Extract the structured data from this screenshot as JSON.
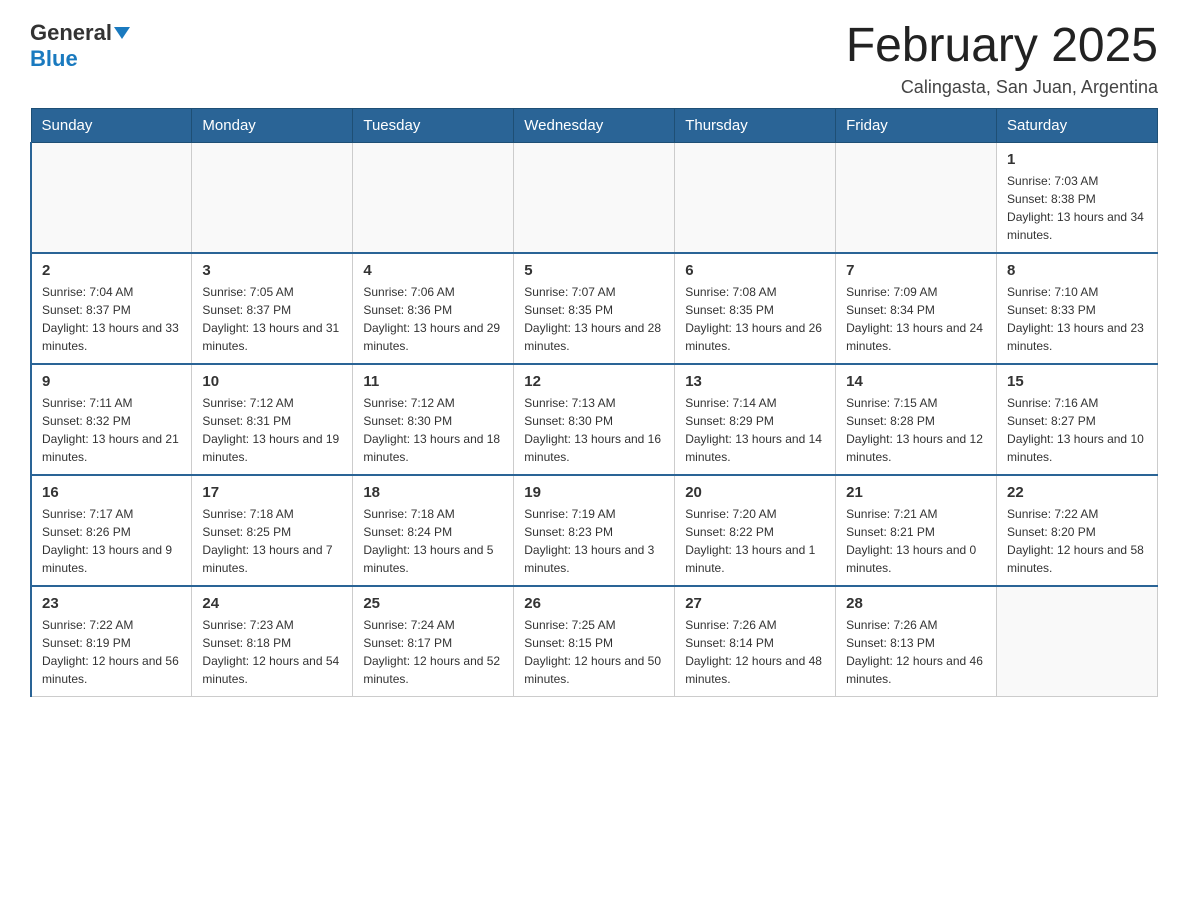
{
  "header": {
    "logo_general": "General",
    "logo_blue": "Blue",
    "title": "February 2025",
    "subtitle": "Calingasta, San Juan, Argentina"
  },
  "days_of_week": [
    "Sunday",
    "Monday",
    "Tuesday",
    "Wednesday",
    "Thursday",
    "Friday",
    "Saturday"
  ],
  "weeks": [
    {
      "days": [
        {
          "date": "",
          "info": ""
        },
        {
          "date": "",
          "info": ""
        },
        {
          "date": "",
          "info": ""
        },
        {
          "date": "",
          "info": ""
        },
        {
          "date": "",
          "info": ""
        },
        {
          "date": "",
          "info": ""
        },
        {
          "date": "1",
          "info": "Sunrise: 7:03 AM\nSunset: 8:38 PM\nDaylight: 13 hours and 34 minutes."
        }
      ]
    },
    {
      "days": [
        {
          "date": "2",
          "info": "Sunrise: 7:04 AM\nSunset: 8:37 PM\nDaylight: 13 hours and 33 minutes."
        },
        {
          "date": "3",
          "info": "Sunrise: 7:05 AM\nSunset: 8:37 PM\nDaylight: 13 hours and 31 minutes."
        },
        {
          "date": "4",
          "info": "Sunrise: 7:06 AM\nSunset: 8:36 PM\nDaylight: 13 hours and 29 minutes."
        },
        {
          "date": "5",
          "info": "Sunrise: 7:07 AM\nSunset: 8:35 PM\nDaylight: 13 hours and 28 minutes."
        },
        {
          "date": "6",
          "info": "Sunrise: 7:08 AM\nSunset: 8:35 PM\nDaylight: 13 hours and 26 minutes."
        },
        {
          "date": "7",
          "info": "Sunrise: 7:09 AM\nSunset: 8:34 PM\nDaylight: 13 hours and 24 minutes."
        },
        {
          "date": "8",
          "info": "Sunrise: 7:10 AM\nSunset: 8:33 PM\nDaylight: 13 hours and 23 minutes."
        }
      ]
    },
    {
      "days": [
        {
          "date": "9",
          "info": "Sunrise: 7:11 AM\nSunset: 8:32 PM\nDaylight: 13 hours and 21 minutes."
        },
        {
          "date": "10",
          "info": "Sunrise: 7:12 AM\nSunset: 8:31 PM\nDaylight: 13 hours and 19 minutes."
        },
        {
          "date": "11",
          "info": "Sunrise: 7:12 AM\nSunset: 8:30 PM\nDaylight: 13 hours and 18 minutes."
        },
        {
          "date": "12",
          "info": "Sunrise: 7:13 AM\nSunset: 8:30 PM\nDaylight: 13 hours and 16 minutes."
        },
        {
          "date": "13",
          "info": "Sunrise: 7:14 AM\nSunset: 8:29 PM\nDaylight: 13 hours and 14 minutes."
        },
        {
          "date": "14",
          "info": "Sunrise: 7:15 AM\nSunset: 8:28 PM\nDaylight: 13 hours and 12 minutes."
        },
        {
          "date": "15",
          "info": "Sunrise: 7:16 AM\nSunset: 8:27 PM\nDaylight: 13 hours and 10 minutes."
        }
      ]
    },
    {
      "days": [
        {
          "date": "16",
          "info": "Sunrise: 7:17 AM\nSunset: 8:26 PM\nDaylight: 13 hours and 9 minutes."
        },
        {
          "date": "17",
          "info": "Sunrise: 7:18 AM\nSunset: 8:25 PM\nDaylight: 13 hours and 7 minutes."
        },
        {
          "date": "18",
          "info": "Sunrise: 7:18 AM\nSunset: 8:24 PM\nDaylight: 13 hours and 5 minutes."
        },
        {
          "date": "19",
          "info": "Sunrise: 7:19 AM\nSunset: 8:23 PM\nDaylight: 13 hours and 3 minutes."
        },
        {
          "date": "20",
          "info": "Sunrise: 7:20 AM\nSunset: 8:22 PM\nDaylight: 13 hours and 1 minute."
        },
        {
          "date": "21",
          "info": "Sunrise: 7:21 AM\nSunset: 8:21 PM\nDaylight: 13 hours and 0 minutes."
        },
        {
          "date": "22",
          "info": "Sunrise: 7:22 AM\nSunset: 8:20 PM\nDaylight: 12 hours and 58 minutes."
        }
      ]
    },
    {
      "days": [
        {
          "date": "23",
          "info": "Sunrise: 7:22 AM\nSunset: 8:19 PM\nDaylight: 12 hours and 56 minutes."
        },
        {
          "date": "24",
          "info": "Sunrise: 7:23 AM\nSunset: 8:18 PM\nDaylight: 12 hours and 54 minutes."
        },
        {
          "date": "25",
          "info": "Sunrise: 7:24 AM\nSunset: 8:17 PM\nDaylight: 12 hours and 52 minutes."
        },
        {
          "date": "26",
          "info": "Sunrise: 7:25 AM\nSunset: 8:15 PM\nDaylight: 12 hours and 50 minutes."
        },
        {
          "date": "27",
          "info": "Sunrise: 7:26 AM\nSunset: 8:14 PM\nDaylight: 12 hours and 48 minutes."
        },
        {
          "date": "28",
          "info": "Sunrise: 7:26 AM\nSunset: 8:13 PM\nDaylight: 12 hours and 46 minutes."
        },
        {
          "date": "",
          "info": ""
        }
      ]
    }
  ]
}
